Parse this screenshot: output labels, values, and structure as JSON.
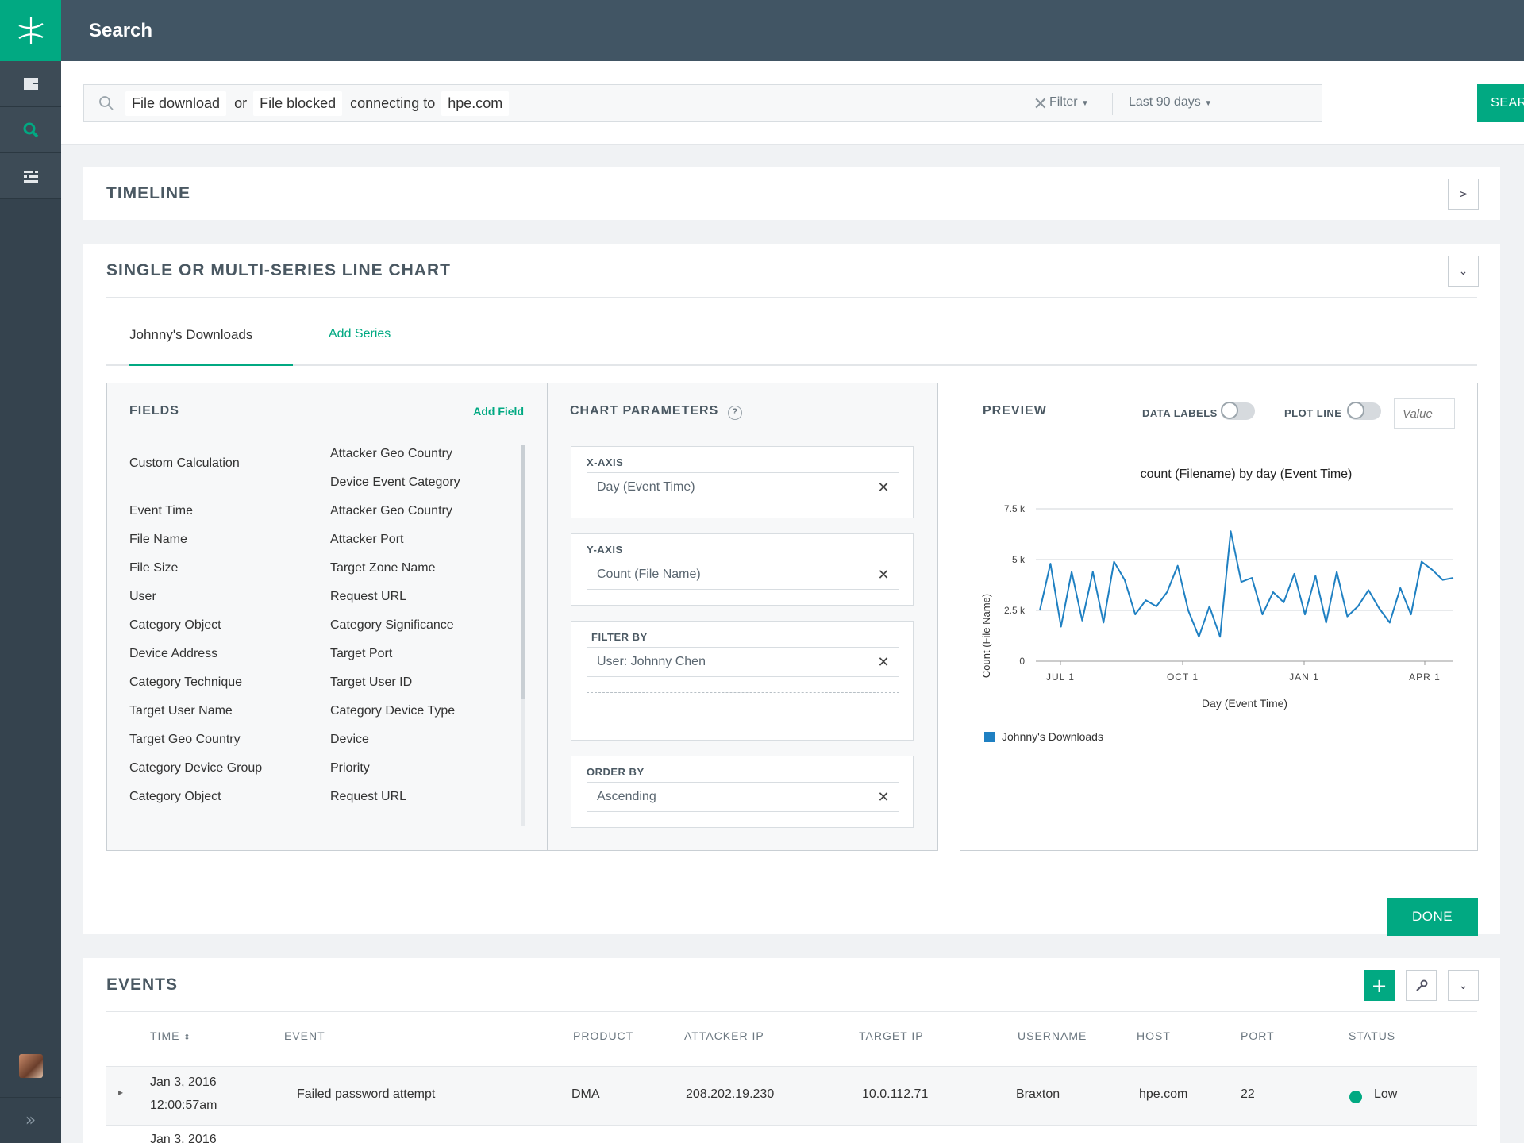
{
  "app": {
    "title": "Search"
  },
  "sidebar": {
    "items": [
      "dashboard",
      "search",
      "settings"
    ]
  },
  "search": {
    "tokens": [
      "File download",
      "or",
      "File blocked",
      "connecting to",
      "hpe.com"
    ],
    "filter_label": "Filter",
    "range_label": "Last 90 days",
    "button_label": "SEARCH"
  },
  "timeline": {
    "title": "TIMELINE"
  },
  "chart_builder": {
    "title": "SINGLE OR MULTI-SERIES LINE CHART",
    "tabs": [
      "Johnny's Downloads",
      "Add Series"
    ],
    "fields": {
      "title": "FIELDS",
      "add_label": "Add Field",
      "left": [
        "Custom Calculation",
        "Event Time",
        "File Name",
        "File Size",
        "User",
        "Category Object",
        "Device Address",
        "Category Technique",
        "Target User Name",
        "Target Geo Country",
        "Category Device Group",
        "Category Object"
      ],
      "right": [
        "Attacker Geo Country",
        "Device Event Category",
        "Attacker Geo Country",
        "Attacker Port",
        "Target Zone Name",
        "Request URL",
        "Category Significance",
        "Target Port",
        "Target User ID",
        "Category Device Type",
        "Device",
        "Priority",
        "Request URL"
      ]
    },
    "params": {
      "title": "CHART PARAMETERS",
      "help": "?",
      "x_axis_label": "X-AXIS",
      "x_axis_value": "Day (Event Time)",
      "y_axis_label": "Y-AXIS",
      "y_axis_value": "Count (File Name)",
      "filter_label": "FILTER BY",
      "filter_value": "User: Johnny Chen",
      "order_label": "ORDER BY",
      "order_value": "Ascending"
    },
    "preview": {
      "title": "PREVIEW",
      "data_labels": "DATA LABELS",
      "plot_line": "PLOT LINE",
      "value_placeholder": "Value"
    },
    "done_label": "DONE"
  },
  "chart_data": {
    "type": "line",
    "title": "count (Filename) by day (Event Time)",
    "xlabel": "Day (Event Time)",
    "ylabel": "Count (File Name)",
    "ylim": [
      0,
      7500
    ],
    "yticks": [
      "0",
      "2.5 k",
      "5 k",
      "7.5 k"
    ],
    "xticks": [
      "JUL 1",
      "OCT 1",
      "JAN 1",
      "APR 1"
    ],
    "legend_position": "bottom-left",
    "series": [
      {
        "name": "Johnny's Downloads",
        "color": "#1f80c2",
        "values": [
          2500,
          4800,
          1700,
          4400,
          2000,
          4400,
          1900,
          4900,
          4000,
          2300,
          3000,
          2700,
          3400,
          4700,
          2500,
          1200,
          2700,
          1200,
          6400,
          3900,
          4100,
          2300,
          3400,
          2900,
          4300,
          2300,
          4200,
          1900,
          4400,
          2200,
          2700,
          3500,
          2600,
          1900,
          3600,
          2300,
          4900,
          4500,
          4000,
          4100
        ]
      }
    ]
  },
  "events": {
    "title": "EVENTS",
    "columns": [
      "TIME",
      "EVENT",
      "PRODUCT",
      "ATTACKER IP",
      "TARGET IP",
      "USERNAME",
      "HOST",
      "PORT",
      "STATUS"
    ],
    "rows": [
      {
        "date": "Jan 3, 2016",
        "time": "12:00:57am",
        "event": "Failed password attempt",
        "product": "DMA",
        "attacker_ip": "208.202.19.230",
        "target_ip": "10.0.112.71",
        "username": "Braxton",
        "host": "hpe.com",
        "port": "22",
        "status": "Low",
        "status_color": "#01a982"
      }
    ]
  }
}
